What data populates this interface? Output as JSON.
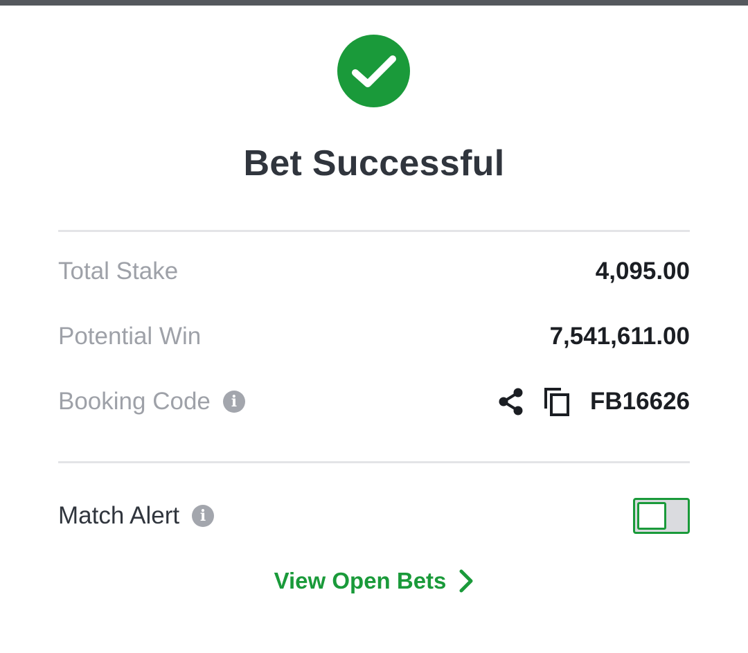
{
  "dialog": {
    "title": "Bet Successful",
    "status_icon": "check-circle-icon",
    "accent_color": "#1a9a3a"
  },
  "summary": {
    "total_stake_label": "Total Stake",
    "total_stake_value": "4,095.00",
    "potential_win_label": "Potential Win",
    "potential_win_value": "7,541,611.00",
    "booking_code_label": "Booking Code",
    "booking_code_value": "FB16626",
    "booking_icons": [
      "info-icon",
      "share-icon",
      "copy-icon"
    ]
  },
  "alerts": {
    "match_alert_label": "Match Alert",
    "match_alert_on": false
  },
  "footer": {
    "view_open_bets_label": "View Open Bets",
    "chevron_icon": "chevron-right-icon"
  }
}
